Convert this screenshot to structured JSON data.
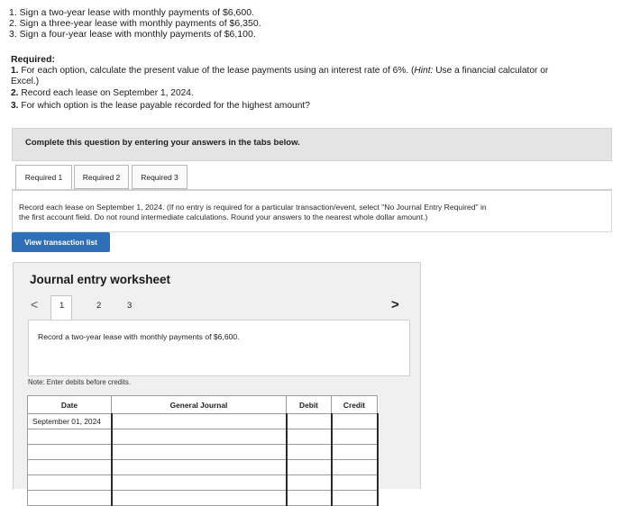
{
  "options": [
    "1. Sign a two-year lease with monthly payments of $6,600.",
    "2. Sign a three-year lease with monthly payments of $6,350.",
    "3. Sign a four-year lease with monthly payments of $6,100."
  ],
  "required": {
    "heading": "Required:",
    "item1_num": "1.",
    "item1_text": "For each option, calculate the present value of the lease payments using an interest rate of 6%. (",
    "item1_hint_label": "Hint:",
    "item1_hint_text": " Use a financial calculator or",
    "item1_cont": "Excel.)",
    "item2_num": "2.",
    "item2_text": "Record each lease on September 1, 2024.",
    "item3_num": "3.",
    "item3_text": "For which option is the lease payable recorded for the highest amount?"
  },
  "complete_bar": "Complete this question by entering your answers in the tabs below.",
  "tabs": [
    "Required 1",
    "Required 2",
    "Required 3"
  ],
  "instructions_line1": "Record each lease on September 1, 2024. (If no entry is required for a particular transaction/event, select \"No Journal Entry Required\" in",
  "instructions_line2": "the first account field. Do not round intermediate calculations. Round your answers to the nearest whole dollar amount.)",
  "view_button": "View transaction list",
  "worksheet": {
    "title": "Journal entry worksheet",
    "pages": [
      "1",
      "2",
      "3"
    ],
    "prev": "<",
    "next": ">",
    "record_text": "Record a two-year lease with monthly payments of $6,600.",
    "note": "Note: Enter debits before credits.",
    "columns": [
      "Date",
      "General Journal",
      "Debit",
      "Credit"
    ],
    "first_date": "September 01, 2024"
  }
}
